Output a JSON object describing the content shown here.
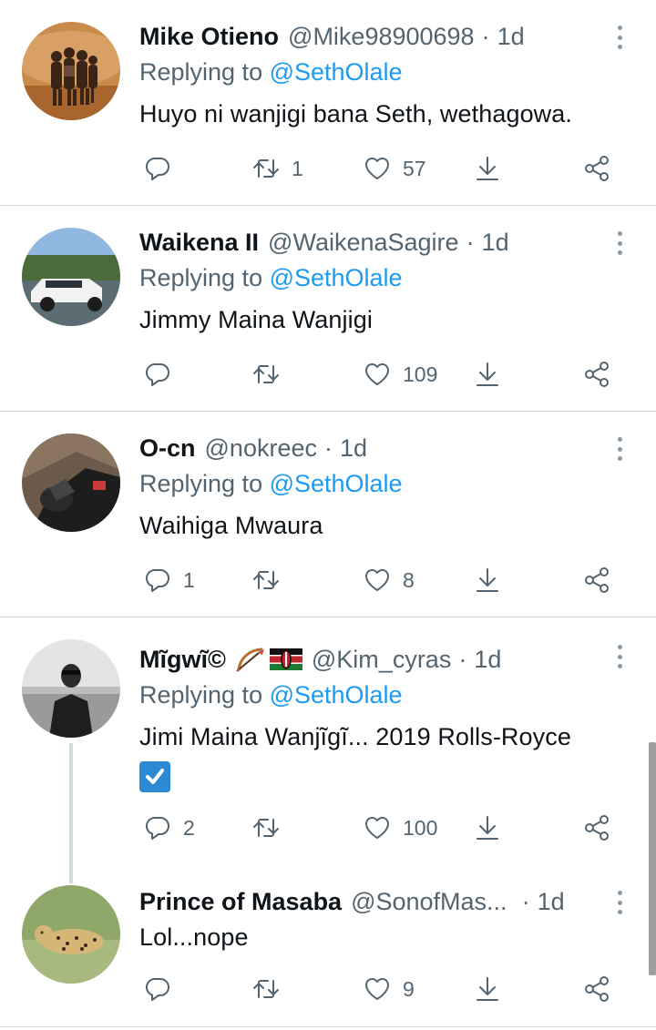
{
  "tweets": [
    {
      "name": "Mike Otieno",
      "handle": "@Mike98900698",
      "time": "1d",
      "replying_label": "Replying to ",
      "replying_to": "@SethOlale",
      "text": "Huyo ni wanjigi bana Seth, wethagowa.",
      "replies": "",
      "retweets": "1",
      "likes": "57"
    },
    {
      "name": "Waikena II",
      "handle": "@WaikenaSagire",
      "time": "1d",
      "replying_label": "Replying to ",
      "replying_to": "@SethOlale",
      "text": "Jimmy Maina Wanjigi",
      "replies": "",
      "retweets": "",
      "likes": "109"
    },
    {
      "name": "O-cn",
      "handle": "@nokreec",
      "time": "1d",
      "replying_label": "Replying to ",
      "replying_to": "@SethOlale",
      "text": "Waihiga Mwaura",
      "replies": "1",
      "retweets": "",
      "likes": "8"
    },
    {
      "name": "Mĩgwĩ©",
      "handle": "@Kim_cyras",
      "time": "1d",
      "replying_label": "Replying to ",
      "replying_to": "@SethOlale",
      "text": "Jimi Maina Wanjĩgĩ... 2019 Rolls-Royce",
      "replies": "2",
      "retweets": "",
      "likes": "100"
    },
    {
      "name": "Prince of Masaba",
      "handle": "@SonofMas...",
      "time": "1d",
      "text": "Lol...nope",
      "replies": "",
      "retweets": "",
      "likes": "9"
    }
  ],
  "separator": "·",
  "icons": [
    "reply-icon",
    "retweet-icon",
    "like-icon",
    "download-icon",
    "share-icon",
    "more-icon",
    "bow-emoji",
    "kenya-flag-emoji",
    "check-emoji"
  ],
  "colors": {
    "link": "#1d9bf0",
    "secondary": "#536471",
    "divider": "#cfd9de"
  }
}
